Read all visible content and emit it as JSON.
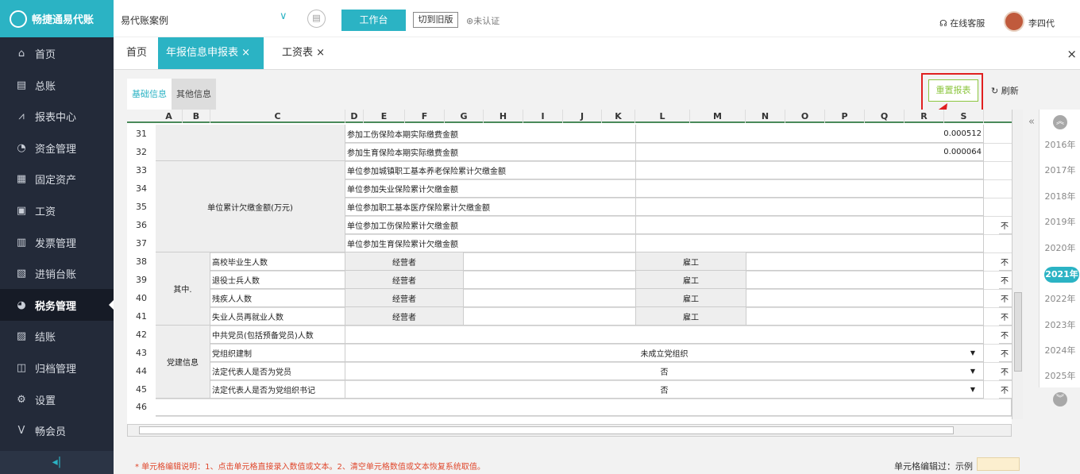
{
  "app": {
    "logo_text": "畅捷通易代账"
  },
  "sidebar": {
    "items": [
      {
        "label": "首页",
        "icon": "home-icon"
      },
      {
        "label": "总账",
        "icon": "ledger-icon"
      },
      {
        "label": "报表中心",
        "icon": "chart-icon"
      },
      {
        "label": "资金管理",
        "icon": "money-icon"
      },
      {
        "label": "固定资产",
        "icon": "asset-icon"
      },
      {
        "label": "工资",
        "icon": "salary-icon"
      },
      {
        "label": "发票管理",
        "icon": "invoice-icon"
      },
      {
        "label": "进销台账",
        "icon": "stock-icon"
      },
      {
        "label": "税务管理",
        "icon": "tax-icon",
        "active": true
      },
      {
        "label": "结账",
        "icon": "close-books-icon"
      },
      {
        "label": "归档管理",
        "icon": "archive-icon"
      },
      {
        "label": "设置",
        "icon": "gear-icon"
      },
      {
        "label": "畅会员",
        "icon": "vip-icon"
      }
    ],
    "collapse_icon": "◂|"
  },
  "topbar": {
    "account": "易代账案例",
    "workbench": "工作台",
    "old_version": "切到旧版",
    "cert": "未认证",
    "service": "在线客服",
    "user": "李四代"
  },
  "tabs": [
    {
      "label": "首页",
      "closable": false
    },
    {
      "label": "年报信息申报表",
      "closable": true,
      "active": true
    },
    {
      "label": "工资表",
      "closable": true
    }
  ],
  "close_all": "×",
  "subtabs": [
    "基础信息",
    "其他信息"
  ],
  "toolbar": {
    "reset": "重置报表",
    "refresh": "刷新"
  },
  "sheet": {
    "columns": [
      "A",
      "B",
      "C",
      "D",
      "E",
      "F",
      "G",
      "H",
      "I",
      "J",
      "K",
      "L",
      "M",
      "N",
      "O",
      "P",
      "Q",
      "R",
      "S"
    ],
    "rows": [
      "31",
      "32",
      "33",
      "34",
      "35",
      "36",
      "37",
      "38",
      "39",
      "40",
      "41",
      "42",
      "43",
      "44",
      "45",
      "46"
    ],
    "labels": {
      "r31": "参加工伤保险本期实际缴费金额",
      "r31v": "0.000512",
      "r32": "参加生育保险本期实际缴费金额",
      "r32v": "0.000064",
      "r33": "单位参加城镇职工基本养老保险累计欠缴金额",
      "r34": "单位参加失业保险累计欠缴金额",
      "r35": "单位参加职工基本医疗保险累计欠缴金额",
      "r36": "单位参加工伤保险累计欠缴金额",
      "r37": "单位参加生育保险累计欠缴金额",
      "group_arrears": "单位累计欠缴金额(万元)",
      "group_among": "其中.",
      "group_party": "党建信息",
      "r38": "高校毕业生人数",
      "r39": "退役士兵人数",
      "r40": "残疾人人数",
      "r41": "失业人员再就业人数",
      "operator": "经营者",
      "employee": "雇工",
      "r42": "中共党员(包括预备党员)人数",
      "r43": "党组织建制",
      "r43v": "未成立党组织",
      "r44": "法定代表人是否为党员",
      "r44v": "否",
      "r45": "法定代表人是否为党组织书记",
      "r45v": "否",
      "col_s": "不"
    }
  },
  "years": [
    "2016年",
    "2017年",
    "2018年",
    "2019年",
    "2020年",
    "2021年",
    "2022年",
    "2023年",
    "2024年",
    "2025年"
  ],
  "active_year": "2021年",
  "footer": {
    "note": "* 单元格编辑说明：1、点击单元格直接录入数值或文本。2、清空单元格数值或文本恢复系统取值。",
    "prompt": "单元格编辑过：示例"
  }
}
